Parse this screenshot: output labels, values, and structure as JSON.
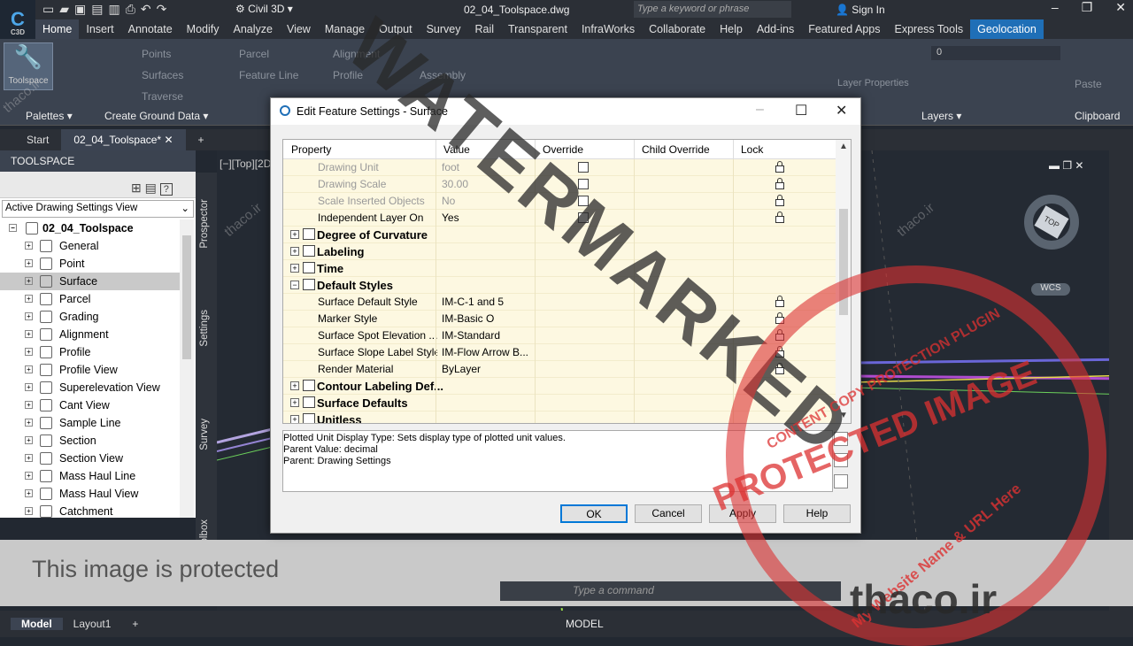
{
  "app": {
    "logo_text": "C",
    "logo_sub": "C3D",
    "workspace": "Civil 3D",
    "doc_title": "02_04_Toolspace.dwg",
    "search_placeholder": "Type a keyword or phrase",
    "sign_in": "Sign In"
  },
  "ribbon_tabs": [
    "Home",
    "Insert",
    "Annotate",
    "Modify",
    "Analyze",
    "View",
    "Manage",
    "Output",
    "Survey",
    "Rail",
    "Transparent",
    "InfraWorks",
    "Collaborate",
    "Help",
    "Add-ins",
    "Featured Apps",
    "Express Tools",
    "Geolocation"
  ],
  "ribbon": {
    "toolspace_btn": "Toolspace",
    "palettes": "Palettes",
    "create_ground": "Create Ground Data",
    "points": "Points",
    "surfaces": "Surfaces",
    "traverse": "Traverse",
    "parcel": "Parcel",
    "feature_line": "Feature Line",
    "alignment": "Alignment",
    "profile": "Profile",
    "assembly": "Assembly",
    "layer_properties": "Layer Properties",
    "layers": "Layers",
    "paste": "Paste",
    "clipboard": "Clipboard",
    "layer_value": "0"
  },
  "doc_tabs": [
    "Start",
    "02_04_Toolspace*"
  ],
  "toolspace": {
    "header": "TOOLSPACE",
    "view": "Active Drawing Settings View",
    "root": "02_04_Toolspace",
    "items": [
      "General",
      "Point",
      "Surface",
      "Parcel",
      "Grading",
      "Alignment",
      "Profile",
      "Profile View",
      "Superelevation View",
      "Cant View",
      "Sample Line",
      "Section",
      "Section View",
      "Mass Haul Line",
      "Mass Haul View",
      "Catchment"
    ],
    "side_tabs": [
      "Prospector",
      "Settings",
      "Survey",
      "Toolbox"
    ]
  },
  "viewport_label": "[−][Top][2D",
  "dialog": {
    "title": "Edit Feature Settings - Surface",
    "columns": [
      "Property",
      "Value",
      "Override",
      "Child Override",
      "Lock"
    ],
    "rows": [
      {
        "type": "prop",
        "name": "Drawing Unit",
        "value": "foot",
        "override": true,
        "lock": true,
        "gray": true
      },
      {
        "type": "prop",
        "name": "Drawing Scale",
        "value": "30.00",
        "override": true,
        "lock": true,
        "gray": true
      },
      {
        "type": "prop",
        "name": "Scale Inserted Objects",
        "value": "No",
        "override": true,
        "lock": true,
        "gray": true
      },
      {
        "type": "prop",
        "name": "Independent Layer On",
        "value": "Yes",
        "override": true,
        "lock": true,
        "gray": false
      },
      {
        "type": "group",
        "name": "Degree of Curvature",
        "exp": "+"
      },
      {
        "type": "group",
        "name": "Labeling",
        "exp": "+"
      },
      {
        "type": "group",
        "name": "Time",
        "exp": "+"
      },
      {
        "type": "group",
        "name": "Default Styles",
        "exp": "−"
      },
      {
        "type": "prop",
        "name": "Surface Default Style",
        "value": "IM-C-1 and 5",
        "override": false,
        "lock": true,
        "gray": false
      },
      {
        "type": "prop",
        "name": "Marker Style",
        "value": "IM-Basic O",
        "override": false,
        "lock": true,
        "gray": false
      },
      {
        "type": "prop",
        "name": "Surface Spot Elevation ...",
        "value": "IM-Standard",
        "override": false,
        "lock": true,
        "gray": false
      },
      {
        "type": "prop",
        "name": "Surface Slope Label Style",
        "value": "IM-Flow Arrow B...",
        "override": false,
        "lock": true,
        "gray": false
      },
      {
        "type": "prop",
        "name": "Render Material",
        "value": "ByLayer",
        "override": false,
        "lock": true,
        "gray": false
      },
      {
        "type": "group",
        "name": "Contour Labeling Def...",
        "exp": "+"
      },
      {
        "type": "group",
        "name": "Surface Defaults",
        "exp": "+"
      },
      {
        "type": "group",
        "name": "Unitless",
        "exp": "+"
      }
    ],
    "description": [
      "Plotted Unit Display Type: Sets display type of plotted unit values.",
      "Parent Value: decimal",
      "Parent: Drawing Settings"
    ],
    "buttons": {
      "ok": "OK",
      "cancel": "Cancel",
      "apply": "Apply",
      "help": "Help"
    }
  },
  "command_placeholder": "Type a command",
  "protected_text": "This image is protected",
  "layout_tabs": [
    "Model",
    "Layout1"
  ],
  "status_model": "MODEL",
  "navcube": {
    "top": "TOP",
    "n": "N",
    "s": "S",
    "e": "E",
    "w": "W",
    "wcs": "WCS"
  },
  "watermarks": {
    "main": "WATERMARKED",
    "stamp1": "PROTECTED IMAGE",
    "stamp2": "CONTENT COPY PROTECTION PLUGIN",
    "stamp3": "My Website Name & URL Here",
    "brand": "thaco.ir",
    "small": "thaco.ir"
  }
}
